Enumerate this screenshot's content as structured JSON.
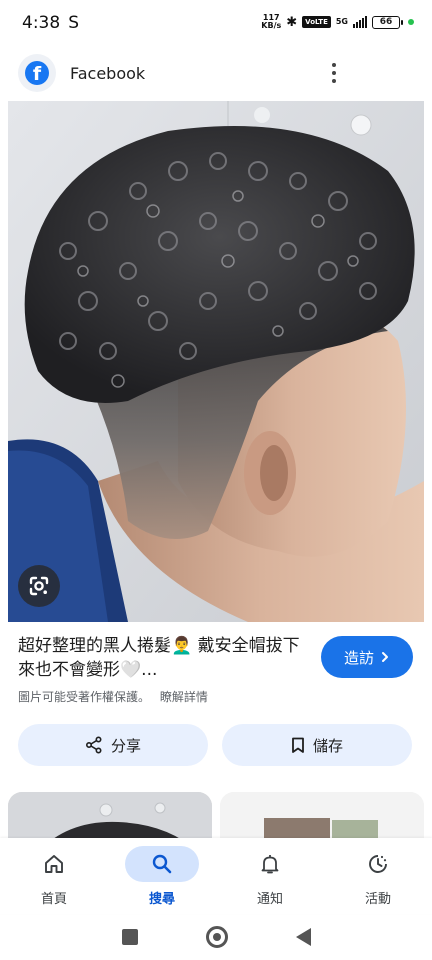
{
  "status_bar": {
    "time": "4:38",
    "carrier_indicator": "S",
    "net_speed_value": "117",
    "net_speed_unit": "KB/s",
    "network": "5G",
    "battery": "66",
    "icons": [
      "bluetooth-icon",
      "volte-icon",
      "signal-icon",
      "battery-icon"
    ]
  },
  "header": {
    "source_name": "Facebook",
    "logo_letter": "f",
    "more_icon": "more-vert-icon"
  },
  "image": {
    "lens_icon": "google-lens-icon"
  },
  "result": {
    "title": "超好整理的黑人捲髮👨‍🦱 戴安全帽拔下來也不會變形🤍...",
    "visit_label": "造訪",
    "visit_icon": "chevron-right-icon",
    "copyright_text": "圖片可能受著作權保護。",
    "learn_more": "瞭解詳情"
  },
  "actions": {
    "share_label": "分享",
    "share_icon": "share-icon",
    "save_label": "儲存",
    "save_icon": "bookmark-icon"
  },
  "bottom_nav": {
    "items": [
      {
        "label": "首頁",
        "icon": "home-icon",
        "active": false
      },
      {
        "label": "搜尋",
        "icon": "search-icon",
        "active": true
      },
      {
        "label": "通知",
        "icon": "bell-icon",
        "active": false
      },
      {
        "label": "活動",
        "icon": "activity-icon",
        "active": false
      }
    ]
  },
  "colors": {
    "accent": "#1a73e8",
    "facebook_blue": "#1877f2",
    "chip_bg": "#e8f0fe",
    "nav_active_bg": "#d3e3fd",
    "nav_active_text": "#0b57d0"
  }
}
